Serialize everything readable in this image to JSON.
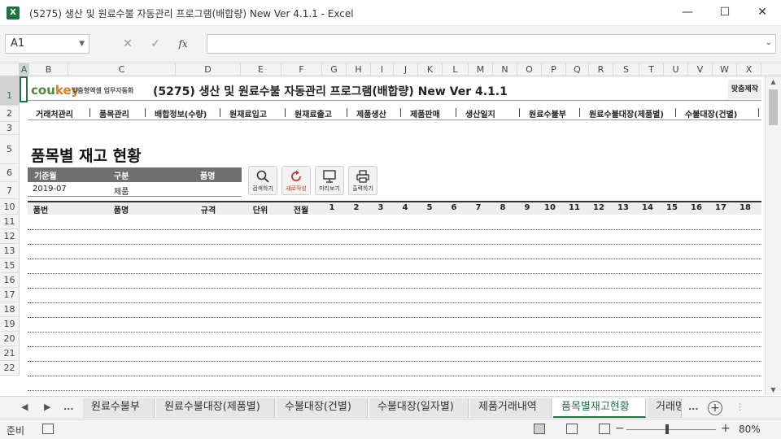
{
  "window": {
    "title": "(5275) 생산 및 원료수불 자동관리 프로그램(배합량) New Ver 4.1.1 - Excel",
    "app_icon": "X"
  },
  "formula_bar": {
    "name_box": "A1",
    "cancel_glyph": "✕",
    "enter_glyph": "✓",
    "fx_glyph": "fx",
    "formula": ""
  },
  "columns": [
    "A",
    "B",
    "C",
    "D",
    "E",
    "F",
    "G",
    "H",
    "I",
    "J",
    "K",
    "L",
    "M",
    "N",
    "O",
    "P",
    "Q",
    "R",
    "S",
    "T",
    "U",
    "V",
    "W",
    "X"
  ],
  "rows": [
    "1",
    "2",
    "3",
    "5",
    "6",
    "7",
    "10",
    "11",
    "12",
    "13",
    "15",
    "16",
    "17",
    "18",
    "19",
    "20",
    "21",
    "22"
  ],
  "banner": {
    "logo_main": "cou",
    "logo_accent": "key",
    "logo_sub": "맞춤형엑셀 업무자동화",
    "title": "(5275) 생산 및 원료수불 자동관리 프로그램(배합량) New Ver 4.1.1",
    "right_label": "맞춤제작"
  },
  "menu": [
    "거래처관리",
    "품목관리",
    "배합정보(수량)",
    "원재료입고",
    "원재료출고",
    "제품생산",
    "제품판매",
    "생산일지",
    "원료수불부",
    "원료수불대장(제품별)",
    "수불대장(건별)"
  ],
  "page_heading": "품목별 재고 현황",
  "filter": {
    "headers": [
      "기준월",
      "구분",
      "품명"
    ],
    "values": [
      "2019-07",
      "제품",
      ""
    ]
  },
  "tools": [
    {
      "label": "검색하기",
      "icon": "search-icon"
    },
    {
      "label": "새로작성",
      "icon": "refresh-icon"
    },
    {
      "label": "미리보기",
      "icon": "monitor-icon"
    },
    {
      "label": "출력하기",
      "icon": "printer-icon"
    }
  ],
  "grid_headers": [
    "품번",
    "품명",
    "규격",
    "단위",
    "전월",
    "1",
    "2",
    "3",
    "4",
    "5",
    "6",
    "7",
    "8",
    "9",
    "10",
    "11",
    "12",
    "13",
    "14",
    "15",
    "16",
    "17",
    "18"
  ],
  "sheet_tabs": [
    "원료수불부",
    "원료수불대장(제품별)",
    "수불대장(건별)",
    "수불대장(일자별)",
    "제품거래내역",
    "품목별재고현황",
    "거래명"
  ],
  "active_tab": "품목별재고현황",
  "tab_nav": {
    "prev": "◀",
    "next": "▶",
    "more": "..."
  },
  "status": {
    "ready": "준비",
    "zoom": "80%",
    "zoom_minus": "−",
    "zoom_plus": "+"
  },
  "colors": {
    "excel_green": "#217346",
    "logo_green": "#4d8a3b",
    "logo_orange": "#e07a1f",
    "filter_header_bg": "#707070"
  }
}
